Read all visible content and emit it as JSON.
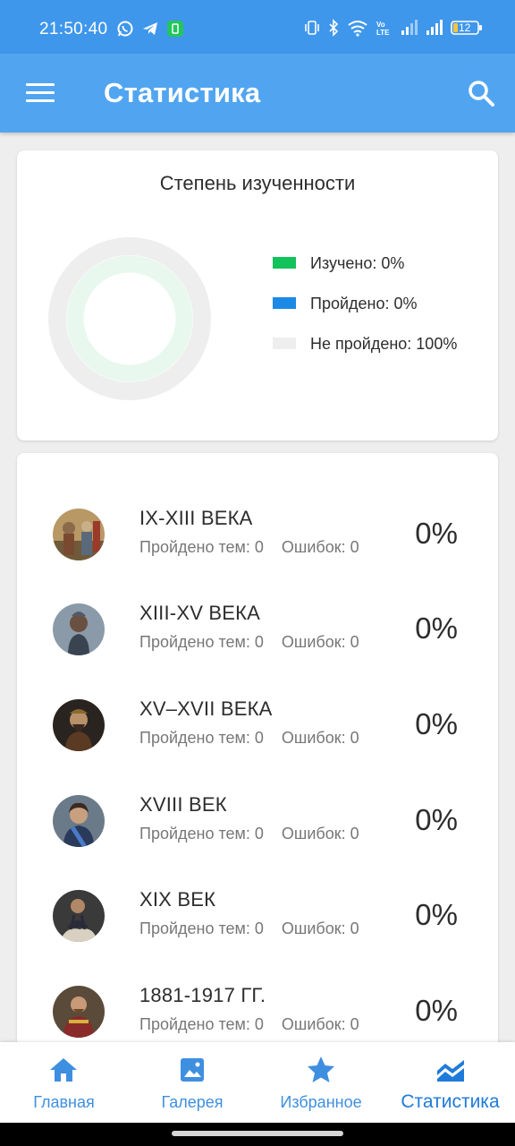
{
  "status_bar": {
    "time": "21:50:40",
    "battery": "12",
    "icons_left": [
      "whatsapp-icon",
      "telegram-icon",
      "notification-app-icon"
    ],
    "icons_right": [
      "vibrate-icon",
      "bluetooth-icon",
      "wifi-icon",
      "volte-icon",
      "signal-icon",
      "signal-icon",
      "battery-icon"
    ]
  },
  "app_bar": {
    "title": "Статистика",
    "menu_icon": "menu-icon",
    "search_icon": "search-icon"
  },
  "progress_card": {
    "title": "Степень изученности",
    "legend": [
      {
        "label": "Изучено: 0%",
        "color": "#12c25a"
      },
      {
        "label": "Пройдено: 0%",
        "color": "#1a8ae6"
      },
      {
        "label": "Не пройдено: 100%",
        "color": "#eeeeee"
      }
    ]
  },
  "periods": [
    {
      "name": "IX-XIII ВЕКА",
      "passed": "Пройдено тем: 0",
      "errors": "Ошибок: 0",
      "percent": "0%"
    },
    {
      "name": "XIII-XV ВЕКА",
      "passed": "Пройдено тем: 0",
      "errors": "Ошибок: 0",
      "percent": "0%"
    },
    {
      "name": "XV–XVII ВЕКА",
      "passed": "Пройдено тем: 0",
      "errors": "Ошибок: 0",
      "percent": "0%"
    },
    {
      "name": "XVIII ВЕК",
      "passed": "Пройдено тем: 0",
      "errors": "Ошибок: 0",
      "percent": "0%"
    },
    {
      "name": "XIX ВЕК",
      "passed": "Пройдено тем: 0",
      "errors": "Ошибок: 0",
      "percent": "0%"
    },
    {
      "name": "1881-1917 ГГ.",
      "passed": "Пройдено тем: 0",
      "errors": "Ошибок: 0",
      "percent": "0%"
    }
  ],
  "bottom_nav": [
    {
      "label": "Главная",
      "icon": "home-icon"
    },
    {
      "label": "Галерея",
      "icon": "gallery-icon"
    },
    {
      "label": "Избранное",
      "icon": "star-icon"
    },
    {
      "label": "Статистика",
      "icon": "chart-icon",
      "active": true
    }
  ],
  "colors": {
    "status_bar": "#3f97ec",
    "app_bar": "#51a5f0",
    "accent": "#1f7bd9",
    "studied": "#12c25a",
    "passed": "#1a8ae6",
    "not_passed": "#eeeeee"
  }
}
